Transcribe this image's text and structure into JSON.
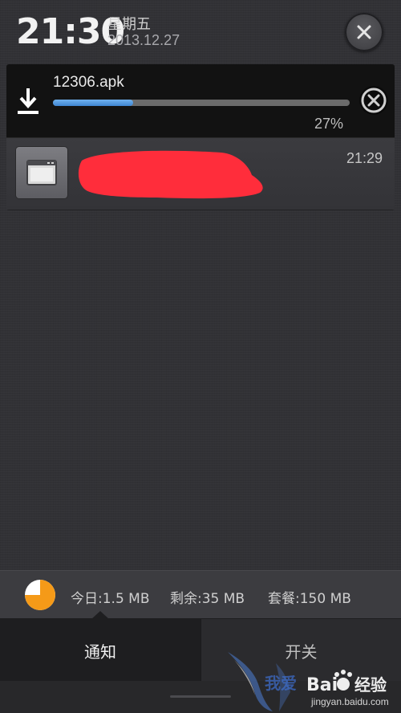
{
  "header": {
    "time": "21:30",
    "weekday": "星期五",
    "date": "2013.12.27",
    "close_icon": "close-icon"
  },
  "download": {
    "icon": "download-icon",
    "filename": "12306.apk",
    "progress": 27,
    "percent_label": "27%",
    "cancel_icon": "cancel-icon",
    "accent_color": "#4a90dc"
  },
  "notification": {
    "icon": "browser-window-icon",
    "time": "21:29",
    "redaction_color": "#ff2d3b"
  },
  "data_usage": {
    "pie_icon": "data-usage-pie-icon",
    "pie_color": "#f59a18",
    "today": "今日:1.5 MB",
    "remaining": "剩余:35 MB",
    "plan": "套餐:150 MB"
  },
  "tabs": [
    {
      "label": "通知",
      "active": true
    },
    {
      "label": "开关",
      "active": false
    }
  ],
  "watermark": {
    "text1": "我爱",
    "text2": "Bai",
    "text3": "经验",
    "text4": "jingyan.baidu.com"
  }
}
